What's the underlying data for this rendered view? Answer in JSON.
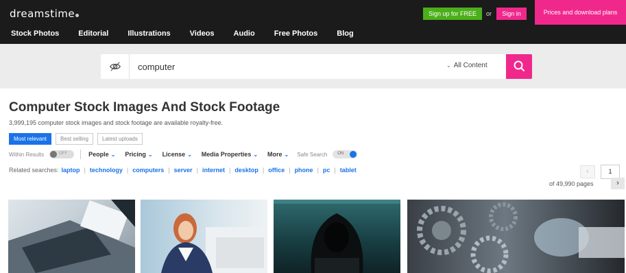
{
  "header": {
    "logo": "dreamstime",
    "signup_label": "Sign up for FREE",
    "or_label": "or",
    "signin_label": "Sign in",
    "prices_label": "Prices and download plans",
    "nav": [
      "Stock Photos",
      "Editorial",
      "Illustrations",
      "Videos",
      "Audio",
      "Free Photos",
      "Blog"
    ],
    "colors": {
      "bar": "#1b1b1b",
      "signup": "#4caf1a",
      "pink": "#f0288c"
    }
  },
  "search": {
    "value": "computer",
    "content_filter": "All Content",
    "eye_icon": "eye-icon",
    "button_icon": "search-icon"
  },
  "results": {
    "title": "Computer Stock Images And Stock Footage",
    "subtitle": "3,999,195 computer stock images and stock footage are available royalty-free.",
    "sort_tabs": [
      "Most relevant",
      "Best selling",
      "Latest uploads"
    ],
    "active_sort": "Most relevant"
  },
  "filters": {
    "within_results_label": "Within Results",
    "within_results_state": "OFF",
    "dropdowns": [
      "People",
      "Pricing",
      "License",
      "Media Properties",
      "More"
    ],
    "safe_search_label": "Safe Search",
    "safe_search_state": "ON"
  },
  "related": {
    "label": "Related searches:",
    "terms": [
      "laptop",
      "technology",
      "computers",
      "server",
      "internet",
      "desktop",
      "office",
      "phone",
      "pc",
      "tablet"
    ]
  },
  "pagination": {
    "current_page": "1",
    "total_text": "of 49,990 pages",
    "prev_icon": "chevron-left-icon",
    "next_icon": "chevron-right-icon"
  },
  "accent_color": "#1a73e8"
}
